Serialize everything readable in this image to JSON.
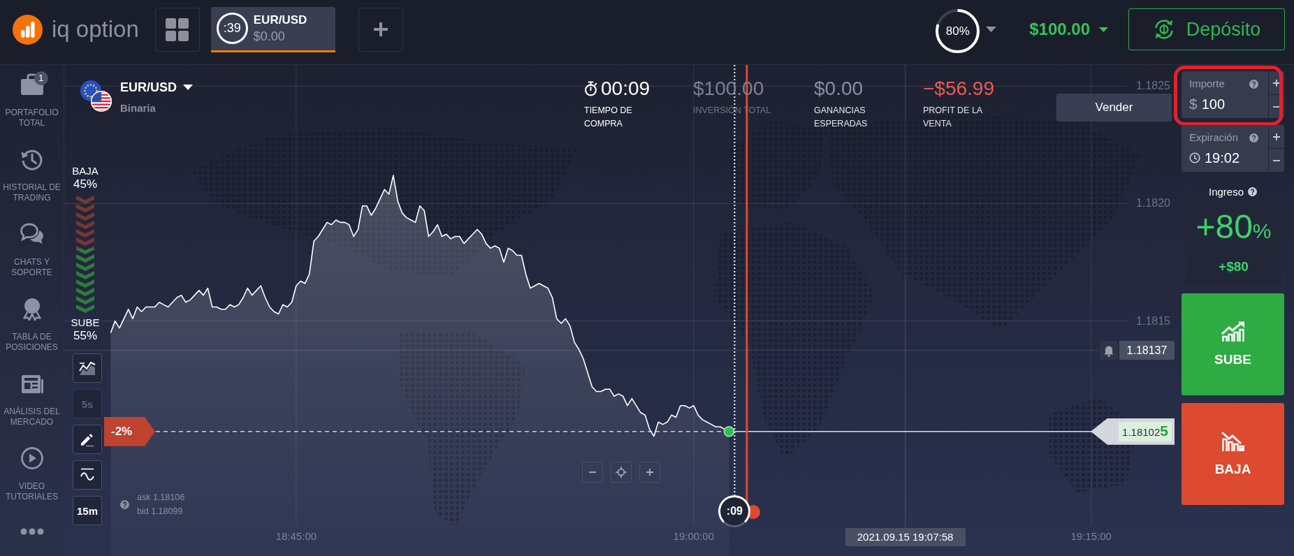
{
  "top_bar": {
    "logo_text": "iq option",
    "asset_tab": {
      "timer": ":39",
      "symbol": "EUR/USD",
      "amount": "$0.00",
      "selected": true
    },
    "profit_ring": {
      "label": "80%",
      "level": 0.8
    },
    "balance": "$100.00",
    "deposit_button": "Depósito"
  },
  "sidebar": {
    "items": [
      {
        "label": "PORTAFOLIO\nTOTAL",
        "badge": "1"
      },
      {
        "label": "HISTORIAL DE\nTRADING"
      },
      {
        "label": "CHATS Y\nSOPORTE"
      },
      {
        "label": "TABLA DE\nPOSICIONES"
      },
      {
        "label": "ANÁLISIS DEL\nMERCADO"
      },
      {
        "label": "VIDEO\nTUTORIALES"
      }
    ]
  },
  "asset": {
    "symbol": "EUR/USD",
    "type": "Binaria"
  },
  "stats": [
    {
      "kind": "timer",
      "value": "00:09",
      "label": "TIEMPO DE\nCOMPRA"
    },
    {
      "kind": "dim",
      "value": "$100.00",
      "label": "INVERSIÓN TOTAL"
    },
    {
      "kind": "neutral",
      "value": "$0.00",
      "label": "GANANCIAS\nESPERADAS"
    },
    {
      "kind": "loss",
      "value": "−$56.99",
      "label": "PROFIT DE LA\nVENTA"
    }
  ],
  "sell_button": "Vender",
  "sentiment": {
    "down_label": "BAJA",
    "down_percent": "45%",
    "up_label": "SUBE",
    "up_percent": "55%",
    "level": 0.55
  },
  "tools": [
    {
      "kind": "icon",
      "disabled": false
    },
    {
      "kind": "text",
      "label": "5s",
      "disabled": true
    },
    {
      "kind": "icon",
      "disabled": false
    },
    {
      "kind": "icon",
      "disabled": false
    },
    {
      "kind": "text",
      "label": "15m",
      "disabled": false
    }
  ],
  "quote": {
    "ask": "ask 1.18106",
    "bid": "bid 1.18099"
  },
  "chart": {
    "alert_price": "1.18137",
    "crosshair_time": "2021.09.15 19:07:58",
    "change_tag": "-2%",
    "current_price": "1.18102**5**",
    "purchase_timer": ":09",
    "chart_data": {
      "type": "area",
      "grid": true,
      "categories": [
        null,
        null,
        null,
        null,
        null,
        null,
        null,
        null,
        null,
        null,
        null,
        null,
        null,
        null,
        null,
        null,
        null,
        null,
        null,
        null,
        null,
        null,
        null,
        null,
        null,
        null,
        null,
        null,
        null,
        null,
        null,
        null,
        null,
        null,
        null,
        null,
        null,
        null,
        null,
        null,
        null,
        null,
        null,
        null,
        null,
        null,
        null,
        null,
        null,
        null,
        null,
        null,
        "18:45:00",
        null,
        null,
        null,
        null,
        null,
        null,
        null,
        null,
        null,
        null,
        null,
        null,
        null,
        null,
        null,
        null,
        null,
        null,
        null,
        null,
        null,
        null,
        null,
        null,
        null,
        null,
        null,
        null,
        null,
        null,
        null,
        null,
        null,
        null,
        null,
        null,
        null,
        null,
        null,
        null,
        null,
        null,
        null,
        null,
        null,
        null,
        null,
        null,
        null,
        null,
        null,
        null,
        null,
        null,
        null,
        null,
        null,
        null,
        null,
        null,
        null,
        null,
        null,
        null,
        null,
        null,
        null,
        null,
        null,
        null,
        null,
        null,
        null,
        null,
        null,
        null,
        null,
        null,
        null,
        null,
        null,
        null,
        null,
        null,
        null,
        null,
        null,
        null,
        null,
        "19:00:00",
        null,
        null,
        null,
        null,
        null,
        null,
        null,
        null,
        null,
        null,
        null,
        null,
        null,
        null,
        null,
        null,
        null,
        null,
        null,
        null,
        null,
        null,
        null,
        null,
        null,
        null,
        null,
        null,
        null,
        null,
        null,
        null,
        null,
        null,
        null,
        null,
        null,
        null,
        null,
        null,
        null,
        null,
        null,
        null,
        null,
        null,
        null,
        null,
        null,
        null,
        null,
        null,
        null,
        null,
        null,
        null,
        null,
        null,
        null,
        null,
        null,
        null,
        null,
        null,
        null,
        null,
        null,
        null,
        null,
        null,
        null,
        null,
        null,
        null,
        null,
        null,
        null,
        null,
        null,
        null,
        null,
        null,
        null,
        null,
        null,
        null,
        null,
        null,
        null,
        "19:15:00",
        null,
        null,
        null,
        null,
        null,
        null,
        null,
        null,
        null,
        null,
        null,
        null,
        null,
        null,
        null,
        null,
        null,
        null,
        null
      ],
      "series": [
        {
          "color": "#ffffff",
          "values": [
            null,
            null,
            null,
            null,
            null,
            null,
            null,
            null,
            null,
            null,
            1.18145,
            1.1815,
            1.18147,
            1.18151,
            1.18155,
            1.18151,
            1.18156,
            1.18154,
            1.18156,
            1.18156,
            1.18156,
            1.18158,
            1.18157,
            1.18156,
            1.18158,
            1.1816,
            1.18161,
            1.18158,
            1.18159,
            1.18161,
            1.18163,
            1.18161,
            1.18164,
            1.18156,
            1.18156,
            1.18155,
            1.18155,
            1.18157,
            1.18156,
            1.18157,
            1.1816,
            1.18164,
            1.18161,
            1.18163,
            1.18165,
            1.1816,
            1.18156,
            1.18154,
            1.18153,
            1.18157,
            1.18156,
            1.18158,
            1.18165,
            1.18167,
            1.18166,
            1.1817,
            1.18184,
            1.18186,
            1.18189,
            1.18192,
            1.18191,
            1.18193,
            1.18192,
            1.18192,
            1.18191,
            1.18186,
            1.18189,
            1.18199,
            1.18199,
            1.18195,
            1.18198,
            1.18202,
            1.18206,
            1.18204,
            1.18212,
            1.18201,
            1.18196,
            1.18194,
            1.18193,
            1.18192,
            1.18199,
            1.18197,
            1.18186,
            1.18188,
            1.18191,
            1.18186,
            1.18187,
            1.18185,
            1.18186,
            1.18186,
            1.18183,
            1.18185,
            1.18187,
            1.18189,
            1.18187,
            1.18183,
            1.18181,
            1.18182,
            1.18181,
            1.18175,
            1.18181,
            1.1818,
            1.18178,
            1.18178,
            1.1817,
            1.18164,
            1.18165,
            1.18166,
            1.18165,
            1.18164,
            1.1816,
            1.18151,
            1.18149,
            1.18151,
            1.18148,
            1.18141,
            1.18138,
            1.18134,
            1.18128,
            1.18122,
            1.1812,
            1.1812,
            1.18121,
            1.18121,
            1.18118,
            1.18119,
            1.18118,
            1.18114,
            1.18117,
            1.18114,
            1.18111,
            1.1811,
            1.18104,
            1.18101,
            1.18107,
            1.18106,
            1.18107,
            1.1811,
            1.18109,
            1.18114,
            1.18114,
            1.18113,
            1.18114,
            1.1811,
            1.18108,
            1.18107,
            1.18106,
            1.18105,
            1.18105,
            1.18104,
            1.18103,
            null,
            null,
            null,
            null,
            null,
            null,
            null,
            null,
            null,
            null,
            null,
            null,
            null,
            null,
            null,
            null,
            null,
            null,
            null,
            null,
            null,
            null,
            null,
            null,
            null,
            null,
            null,
            null,
            null,
            null,
            null,
            null,
            null,
            null,
            null,
            null,
            null,
            null,
            null,
            null,
            null,
            null,
            null,
            null,
            null,
            null,
            null,
            null,
            null,
            null,
            null,
            null,
            null,
            null,
            null,
            null,
            null,
            null,
            null,
            null,
            null,
            null,
            null,
            null,
            null,
            null,
            null,
            null,
            null,
            null,
            null,
            null,
            null,
            null,
            null,
            null,
            null,
            null,
            null,
            null,
            null,
            null,
            null,
            null,
            null,
            null,
            null,
            null,
            null,
            null,
            null,
            null,
            null,
            null,
            null,
            null,
            null,
            null,
            null,
            null,
            null
          ]
        }
      ],
      "ylim": [
        1.1805,
        1.18259
      ],
      "yticks": [
        {
          "value": 1.1825,
          "label": "1.1825"
        },
        {
          "value": 1.182,
          "label": "1.1820"
        },
        {
          "value": 1.1815,
          "label": "1.1815"
        }
      ]
    }
  },
  "trade_panel": {
    "amount": {
      "label": "Importe",
      "currency": "$",
      "value": "100",
      "highlighted": true
    },
    "expiration": {
      "label": "Expiración",
      "value": "19:02"
    },
    "income": {
      "label": "Ingreso",
      "percent": "+80",
      "percent_unit": "%",
      "amount": "+$80"
    },
    "buttons": [
      {
        "kind": "up",
        "label": "SUBE"
      },
      {
        "kind": "down",
        "label": "BAJA"
      }
    ]
  }
}
